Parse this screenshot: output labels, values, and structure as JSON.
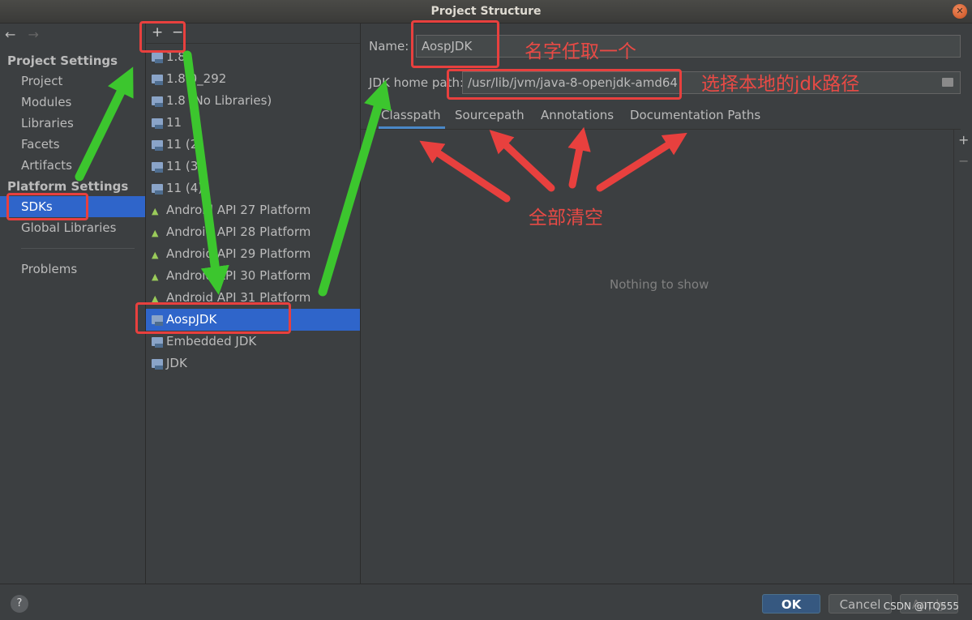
{
  "window": {
    "title": "Project Structure"
  },
  "left_nav": {
    "back": "←",
    "forward": "→",
    "project_settings_header": "Project Settings",
    "project_items": [
      "Project",
      "Modules",
      "Libraries",
      "Facets",
      "Artifacts"
    ],
    "platform_settings_header": "Platform Settings",
    "platform_items": [
      "SDKs",
      "Global Libraries"
    ],
    "problems": "Problems"
  },
  "sdk_toolbar": {
    "add": "+",
    "remove": "−"
  },
  "sdk_list": [
    {
      "label": "1.8",
      "icon": "folder-icon"
    },
    {
      "label": "1.8.0_292",
      "icon": "folder-icon"
    },
    {
      "label": "1.8 (No Libraries)",
      "icon": "folder-icon"
    },
    {
      "label": "11",
      "icon": "folder-icon"
    },
    {
      "label": "11 (2)",
      "icon": "folder-icon"
    },
    {
      "label": "11 (3)",
      "icon": "folder-icon"
    },
    {
      "label": "11 (4)",
      "icon": "folder-icon"
    },
    {
      "label": "Android API 27 Platform",
      "icon": "android-icon"
    },
    {
      "label": "Android API 28 Platform",
      "icon": "android-icon"
    },
    {
      "label": "Android API 29 Platform",
      "icon": "android-icon"
    },
    {
      "label": "Android API 30 Platform",
      "icon": "android-icon"
    },
    {
      "label": "Android API 31 Platform",
      "icon": "android-icon"
    },
    {
      "label": "AospJDK",
      "icon": "folder-icon"
    },
    {
      "label": "Embedded JDK",
      "icon": "folder-icon"
    },
    {
      "label": "JDK",
      "icon": "folder-icon"
    }
  ],
  "details": {
    "name_label": "Name:",
    "name_value": "AospJDK",
    "home_label": "JDK home path:",
    "home_value": "/usr/lib/jvm/java-8-openjdk-amd64",
    "tabs": [
      "Classpath",
      "Sourcepath",
      "Annotations",
      "Documentation Paths"
    ],
    "add_tool": "+",
    "remove_tool": "−",
    "empty_text": "Nothing to show"
  },
  "buttons": {
    "help": "?",
    "ok": "OK",
    "cancel": "Cancel",
    "apply": "Apply"
  },
  "watermark": "CSDN @ITQ555",
  "annotations": {
    "name_note": "名字任取一个",
    "path_note": "选择本地的jdk路径",
    "clear_note": "全部清空"
  },
  "colors": {
    "selection": "#2f65ca",
    "highlight": "#e8403e",
    "arrow_green": "#3cc62e",
    "arrow_red": "#e8403e"
  }
}
